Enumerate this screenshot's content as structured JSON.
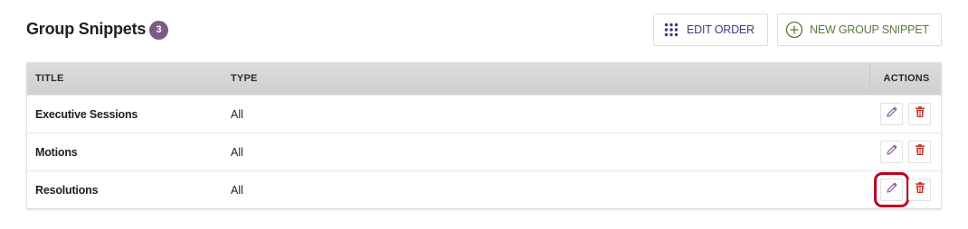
{
  "header": {
    "title": "Group Snippets",
    "count": "3",
    "edit_order_label": "EDIT ORDER",
    "new_snippet_label": "NEW GROUP SNIPPET"
  },
  "table": {
    "columns": {
      "title": "TITLE",
      "type": "TYPE",
      "actions": "ACTIONS"
    },
    "rows": [
      {
        "title": "Executive Sessions",
        "type": "All"
      },
      {
        "title": "Motions",
        "type": "All"
      },
      {
        "title": "Resolutions",
        "type": "All"
      }
    ]
  },
  "icons": {
    "edit_order": "grid-dots-icon",
    "new_snippet": "plus-circle-icon",
    "row_edit": "pencil-icon",
    "row_delete": "trash-icon"
  },
  "colors": {
    "badge": "#7a5a86",
    "edit_order_text": "#3a3a80",
    "new_snippet_text": "#5b7a3c",
    "pencil": "#8a5a9e",
    "trash": "#c0392b",
    "highlight": "#c00020"
  }
}
